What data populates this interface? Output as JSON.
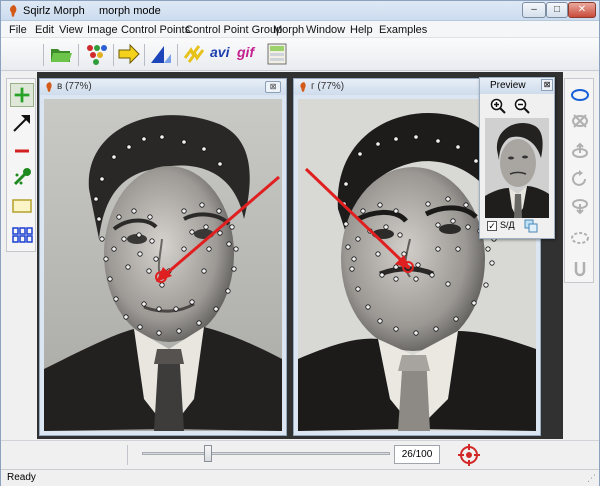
{
  "window": {
    "app_title": "Sqirlz Morph",
    "mode": "morph mode",
    "min_glyph": "–",
    "max_glyph": "□",
    "close_glyph": "✕"
  },
  "menu": [
    "File",
    "Edit",
    "View",
    "Image",
    "Control Points",
    "Control Point Group",
    "Morph",
    "Window",
    "Help",
    "Examples"
  ],
  "toolbar": {
    "avi_label": "avi",
    "gif_label": "gif"
  },
  "left_tools": [
    "add-point",
    "move-point",
    "delete-point",
    "eyedropper",
    "rectangle",
    "grid"
  ],
  "right_tools": [
    "ellipse",
    "clear",
    "rotate-up",
    "rotate",
    "rotate-down",
    "dashed-ellipse",
    "undo"
  ],
  "doc_left": {
    "title": "в  (77%)",
    "close_glyph": "⊠"
  },
  "doc_right": {
    "title": "г  (77%)",
    "close_glyph": "⊠"
  },
  "preview": {
    "title": "Preview",
    "close_glyph": "⊠",
    "checkbox_label": "S/Д",
    "checkbox_checked": true
  },
  "bottom": {
    "frame_counter": "26/100",
    "slider_position": 0.26
  },
  "status": {
    "text": "Ready"
  },
  "colors": {
    "arrow": "#e02020",
    "accent_blue": "#1a5fd8"
  }
}
